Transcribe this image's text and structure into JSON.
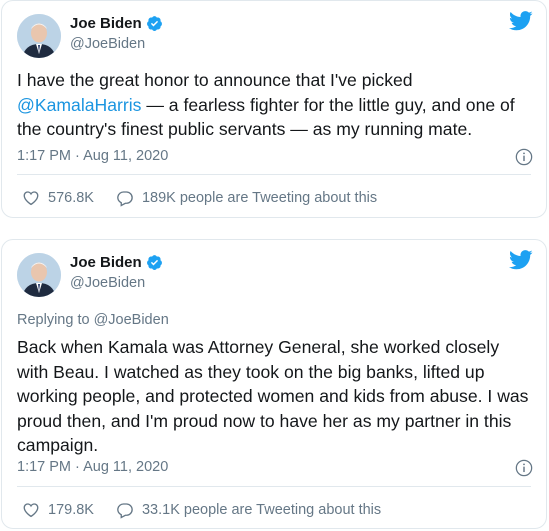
{
  "colors": {
    "link": "#1b95e0",
    "twitter_blue": "#1da1f2",
    "secondary_text": "#657786",
    "border": "#e1e8ed"
  },
  "tweets": [
    {
      "author": {
        "name": "Joe Biden",
        "handle": "@JoeBiden"
      },
      "text_before": "I have the great honor to announce that I've picked ",
      "mention": "@KamalaHarris",
      "text_after": " — a fearless fighter for the little guy, and one of the country's finest public servants — as my running mate.",
      "timestamp": "1:17 PM · Aug 11, 2020",
      "likes": "576.8K",
      "conversation": "189K people are Tweeting about this"
    },
    {
      "author": {
        "name": "Joe Biden",
        "handle": "@JoeBiden"
      },
      "replying_to": "Replying to @JoeBiden",
      "text": "Back when Kamala was Attorney General, she worked closely with Beau. I watched as they took on the big banks, lifted up working people, and protected women and kids from abuse. I was proud then, and I'm proud now to have her as my partner in this campaign.",
      "timestamp": "1:17 PM · Aug 11, 2020",
      "likes": "179.8K",
      "conversation": "33.1K people are Tweeting about this"
    }
  ],
  "icons": {
    "verified": "verified-badge-icon",
    "logo": "twitter-bird-icon",
    "info": "info-icon",
    "like": "heart-icon",
    "conversation": "comment-bubble-icon"
  }
}
